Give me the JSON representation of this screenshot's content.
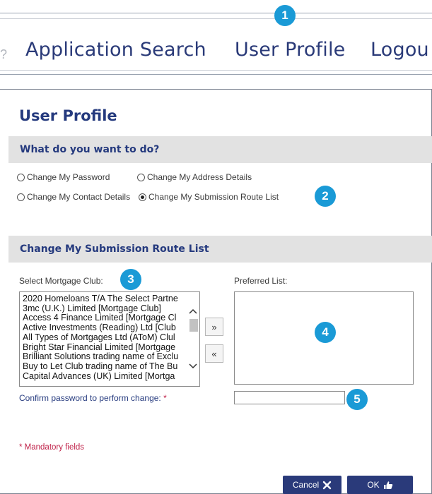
{
  "nav": {
    "items": [
      "Application Search",
      "User Profile",
      "Logou"
    ]
  },
  "callouts": [
    "1",
    "2",
    "3",
    "4",
    "5"
  ],
  "page": {
    "title": "User Profile"
  },
  "section_what": {
    "heading": "What do you want to do?",
    "options": [
      {
        "label": "Change My Password",
        "checked": false
      },
      {
        "label": "Change My Address Details",
        "checked": false
      },
      {
        "label": "Change My Contact Details",
        "checked": false
      },
      {
        "label": "Change My Submission Route List",
        "checked": true
      }
    ]
  },
  "section_route": {
    "heading": "Change My Submission Route List",
    "select_label": "Select Mortgage Club:",
    "preferred_label": "Preferred List:",
    "clubs": [
      "2020 Homeloans T/A The Select Partne",
      "3mc (U.K.) Limited [Mortgage Club]",
      "Access 4 Finance Limited [Mortgage Cl",
      "Active Investments (Reading) Ltd [Club",
      "All Types of Mortgages Ltd (AToM) Clul",
      "Bright Star Financial Limited [Mortgage",
      "Brilliant Solutions trading name of Exclu",
      "Buy to Let Club trading name of The Bu",
      "Capital Advances (UK) Limited [Mortga"
    ],
    "add_label": "»",
    "remove_label": "«",
    "confirm_label": "Confirm password to perform change:",
    "required_marker": "*",
    "password_value": ""
  },
  "footer": {
    "mandatory_note": "* Mandatory fields",
    "cancel_label": "Cancel",
    "ok_label": "OK"
  },
  "colors": {
    "brand_navy": "#253a7e",
    "callout_blue": "#1a9ad6",
    "required_red": "#c0234a",
    "section_bg": "#e2e2e2"
  }
}
